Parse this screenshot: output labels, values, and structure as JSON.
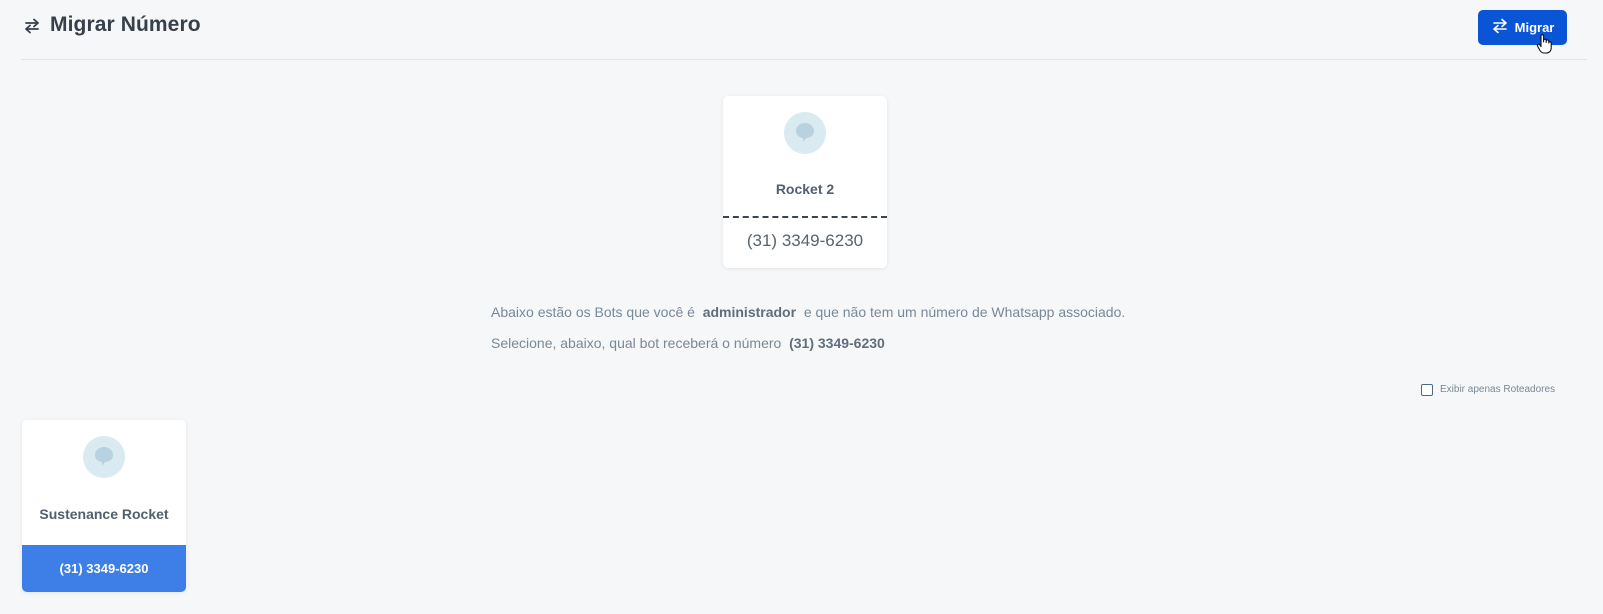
{
  "header": {
    "title": "Migrar Número",
    "title_icon": "swap-arrows-icon",
    "migrate_button_label": "Migrar",
    "migrate_button_color": "#0a55d6"
  },
  "source_bot": {
    "name": "Rocket 2",
    "phone": "(31) 3349-6230",
    "avatar_icon": "chat-bubble-icon"
  },
  "info": {
    "line1_prefix": "Abaixo estão os Bots que você é",
    "line1_bold": "administrador",
    "line1_suffix": "e que não tem um número de Whatsapp associado.",
    "line2_prefix": "Selecione, abaixo, qual bot receberá o número",
    "line2_bold": "(31) 3349-6230"
  },
  "filter": {
    "label": "Exibir apenas Roteadores",
    "checked": false
  },
  "bots": [
    {
      "name": "Sustenance Rocket",
      "phone": "(31) 3349-6230",
      "selected": true,
      "accent_color": "#3d7fe6"
    }
  ]
}
